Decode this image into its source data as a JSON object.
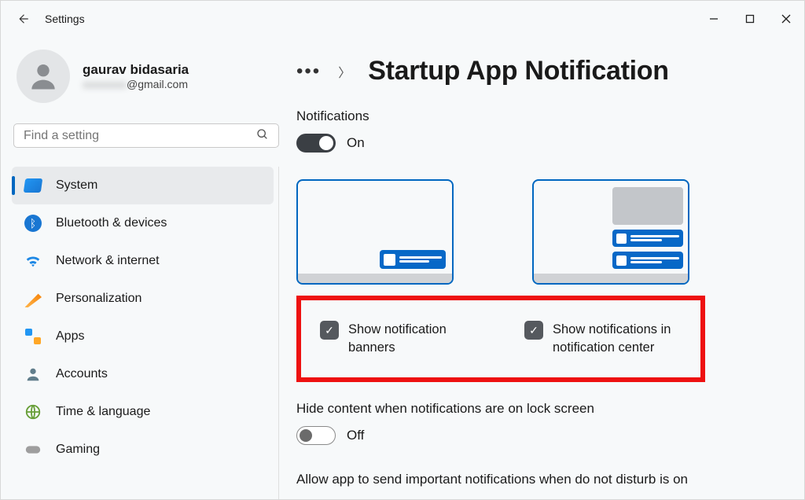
{
  "window": {
    "title": "Settings"
  },
  "user": {
    "name": "gaurav bidasaria",
    "email_masked": "xxxxxxxx",
    "email_domain": "@gmail.com"
  },
  "search": {
    "placeholder": "Find a setting"
  },
  "sidebar": {
    "items": [
      {
        "label": "System",
        "selected": true
      },
      {
        "label": "Bluetooth & devices",
        "selected": false
      },
      {
        "label": "Network & internet",
        "selected": false
      },
      {
        "label": "Personalization",
        "selected": false
      },
      {
        "label": "Apps",
        "selected": false
      },
      {
        "label": "Accounts",
        "selected": false
      },
      {
        "label": "Time & language",
        "selected": false
      },
      {
        "label": "Gaming",
        "selected": false
      }
    ]
  },
  "header": {
    "page_title": "Startup App Notification"
  },
  "main": {
    "notifications_label": "Notifications",
    "notifications_toggle_state": "On",
    "checkbox1": "Show notification banners",
    "checkbox2": "Show notifications in notification center",
    "hide_content_label": "Hide content when notifications are on lock screen",
    "hide_content_toggle_state": "Off",
    "allow_important_label": "Allow app to send important notifications when do not disturb is on"
  }
}
